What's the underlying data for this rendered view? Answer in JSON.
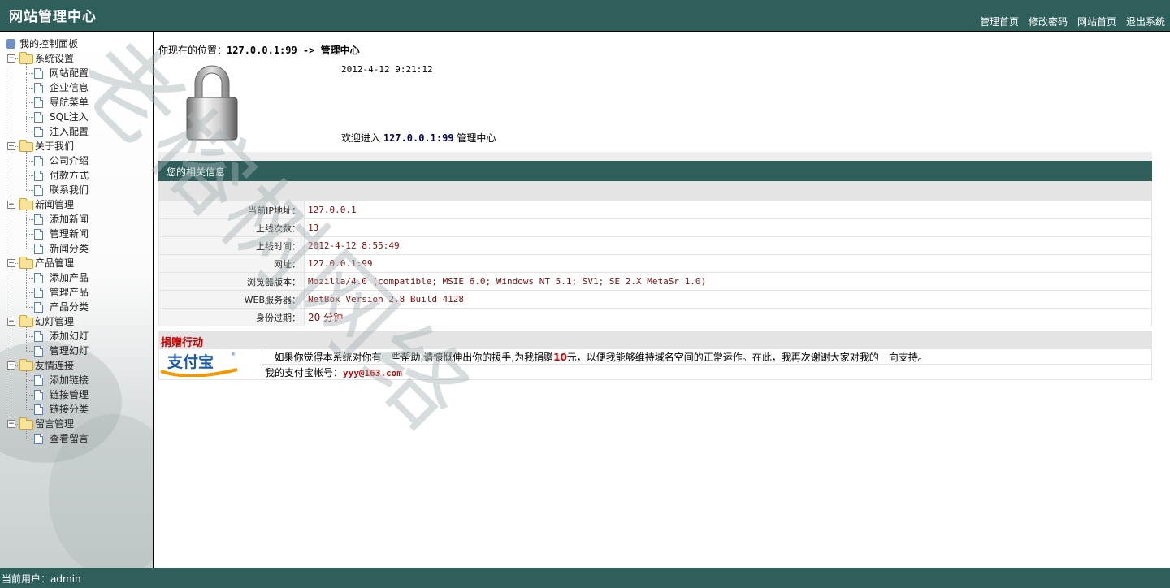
{
  "header": {
    "title": "网站管理中心",
    "nav": [
      "管理首页",
      "修改密码",
      "网站首页",
      "退出系统"
    ]
  },
  "sidebar": {
    "root": "我的控制面板",
    "groups": [
      {
        "label": "系统设置",
        "items": [
          "网站配置",
          "企业信息",
          "导航菜单",
          "SQL注入",
          "注入配置"
        ]
      },
      {
        "label": "关于我们",
        "items": [
          "公司介绍",
          "付款方式",
          "联系我们"
        ]
      },
      {
        "label": "新闻管理",
        "items": [
          "添加新闻",
          "管理新闻",
          "新闻分类"
        ]
      },
      {
        "label": "产品管理",
        "items": [
          "添加产品",
          "管理产品",
          "产品分类"
        ]
      },
      {
        "label": "幻灯管理",
        "items": [
          "添加幻灯",
          "管理幻灯"
        ]
      },
      {
        "label": "友情连接",
        "items": [
          "添加链接",
          "链接管理",
          "链接分类"
        ]
      },
      {
        "label": "留言管理",
        "items": [
          "查看留言"
        ]
      }
    ]
  },
  "main": {
    "location_label": "你现在的位置：",
    "location_path": "127.0.0.1:99 -> 管理中心",
    "datetime": "2012-4-12 9:21:12",
    "welcome_prefix": "欢迎进入",
    "welcome_host": "127.0.0.1:99",
    "welcome_suffix": "管理中心",
    "info_title": "您的相关信息",
    "info_rows": [
      {
        "key": "当前IP地址：",
        "value": "127.0.0.1"
      },
      {
        "key": "上线次数：",
        "value": "13"
      },
      {
        "key": "上线时间：",
        "value": "2012-4-12 8:55:49"
      },
      {
        "key": "网址：",
        "value": "127.0.0.1:99"
      },
      {
        "key": "浏览器版本：",
        "value": "Mozilla/4.0 (compatible; MSIE 6.0; Windows NT 5.1; SV1; SE 2.X MetaSr 1.0)"
      },
      {
        "key": "WEB服务器：",
        "value": "NetBox Version 2.8 Build 4128"
      },
      {
        "key": "身份过期：",
        "value": "20 分钟"
      }
    ],
    "donate_title": "捐赠行动",
    "donate_text_1": "如果你觉得本系统对你有一些帮助,请慷慨伸出你的援手,为我捐赠",
    "donate_amount": "10",
    "donate_text_2": "元，以便我能够维持域名空间的正常运作。在此，我再次谢谢大家对我的一向支持。",
    "alipay_logo_text": "支付宝",
    "alipay_label": "我的支付宝帐号：",
    "alipay_account": "yyy@163.com"
  },
  "watermark_text": "老榕树网络",
  "footer": {
    "current_user": "当前用户：admin"
  },
  "colors": {
    "header": "#2f5f5b",
    "accent_red": "#c80000",
    "value_red": "#7a0f0f",
    "alipay_blue": "#1a5aa8",
    "alipay_orange": "#f39800"
  }
}
